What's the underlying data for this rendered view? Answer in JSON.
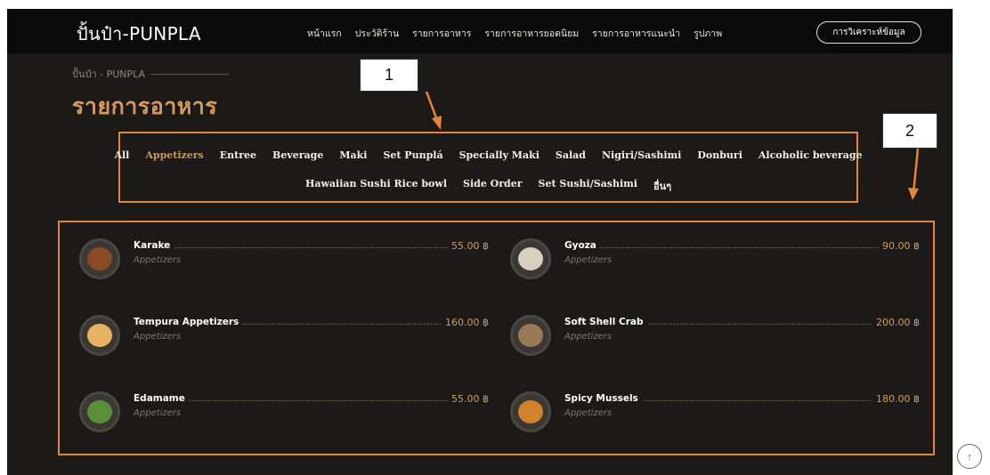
{
  "brand": {
    "logo": "ปั้นป๋า-PUNPLA"
  },
  "nav": {
    "links": [
      "หน้าแรก",
      "ประวัติร้าน",
      "รายการอาหาร",
      "รายการอาหารยอดนิยม",
      "รายการอาหารแนะนำ",
      "รูปภาพ"
    ],
    "cta": "การวิเคราะห์ข้อมูล"
  },
  "breadcrumb": "ปั้นป๋า - PUNPLA",
  "page_title": "รายการอาหาร",
  "callouts": {
    "c1": "1",
    "c2": "2"
  },
  "categories": {
    "row1": [
      "All",
      "Appetizers",
      "Entree",
      "Beverage",
      "Maki",
      "Set Punplá",
      "Specially Maki",
      "Salad",
      "Nigiri/Sashimi",
      "Donburi",
      "Alcoholic beverage"
    ],
    "row2": [
      "Hawaiian Sushi Rice bowl",
      "Side Order",
      "Set Sushi/Sashimi",
      "อื่นๆ"
    ],
    "active": "Appetizers"
  },
  "menu": [
    {
      "name": "Karake",
      "category": "Appetizers",
      "price": "55.00 ฿",
      "dish_color": "#8a4b22"
    },
    {
      "name": "Gyoza",
      "category": "Appetizers",
      "price": "90.00 ฿",
      "dish_color": "#d8cfbf"
    },
    {
      "name": "Tempura Appetizers",
      "category": "Appetizers",
      "price": "160.00 ฿",
      "dish_color": "#e6b460"
    },
    {
      "name": "Soft Shell Crab",
      "category": "Appetizers",
      "price": "200.00 ฿",
      "dish_color": "#9a7a55"
    },
    {
      "name": "Edamame",
      "category": "Appetizers",
      "price": "55.00 ฿",
      "dish_color": "#5a8f3a"
    },
    {
      "name": "Spicy Mussels",
      "category": "Appetizers",
      "price": "180.00 ฿",
      "dish_color": "#d0822a"
    }
  ],
  "colors": {
    "accent": "#d79a5a",
    "annotation": "#e88436",
    "background": "#1b1a18"
  },
  "icons": {
    "back_to_top": "arrow-up-icon"
  }
}
